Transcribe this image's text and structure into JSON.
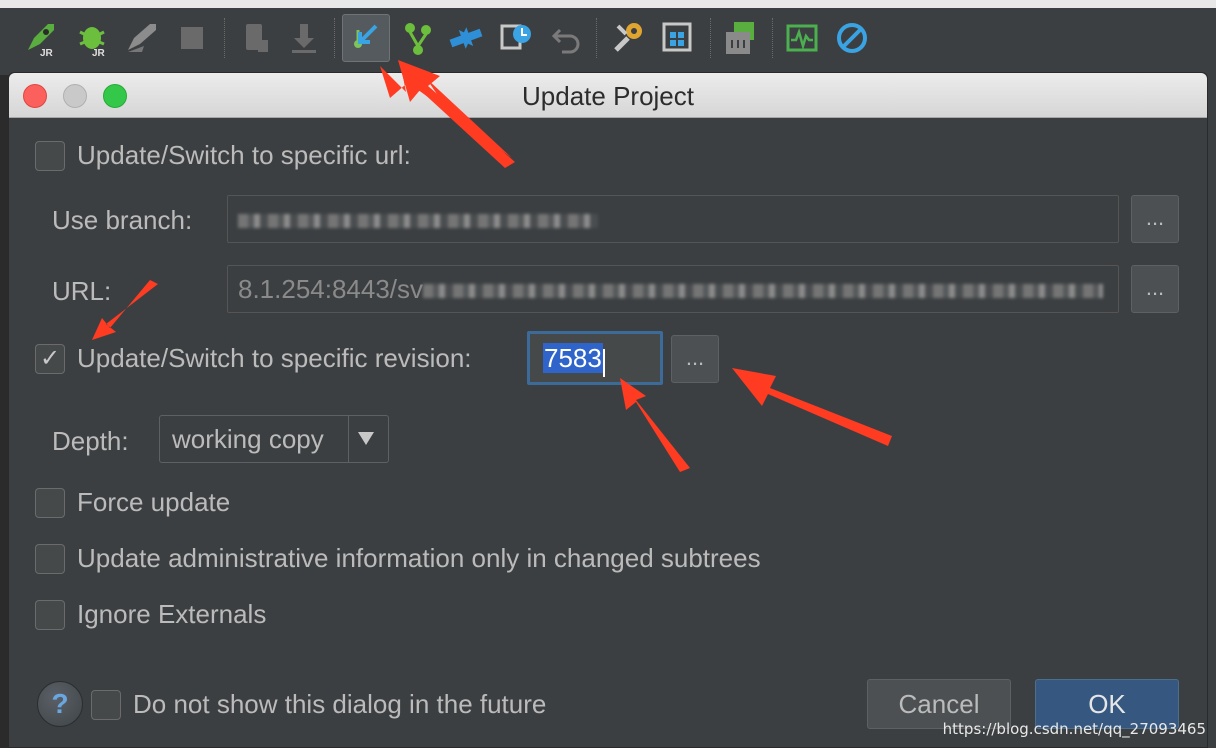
{
  "toolbar": {
    "icons": [
      "rocket-jr-icon",
      "bug-jr-icon",
      "rocket-gray-icon",
      "stop-icon",
      "device-icon",
      "download-icon",
      "vcs-update-icon",
      "vcs-branch-icon",
      "merge-arrows-icon",
      "history-icon",
      "undo-icon",
      "wrench-icon",
      "project-structure-icon",
      "sdk-manager-icon",
      "monitor-icon",
      "no-entry-icon"
    ]
  },
  "dialog": {
    "title": "Update Project",
    "url_checkbox_label": "Update/Switch to specific url:",
    "branch_label": "Use branch:",
    "branch_value": "",
    "url_label": "URL:",
    "url_value": "8.1.254:8443/sv",
    "browse_label": "...",
    "revision_checkbox_label": "Update/Switch to specific revision:",
    "revision_value": "7583",
    "depth_label": "Depth:",
    "depth_value": "working copy",
    "force_update_label": "Force update",
    "admin_info_label": "Update administrative information only in changed subtrees",
    "ignore_externals_label": "Ignore Externals",
    "dont_show_label": "Do not show this dialog in the future",
    "help_label": "?",
    "cancel_label": "Cancel",
    "ok_label": "OK",
    "checked_mark": "✓"
  },
  "watermark": "https://blog.csdn.net/qq_27093465",
  "colors": {
    "annotation_arrow": "#ff3b22",
    "selection": "#2f65ca",
    "ok_button": "#365880"
  }
}
